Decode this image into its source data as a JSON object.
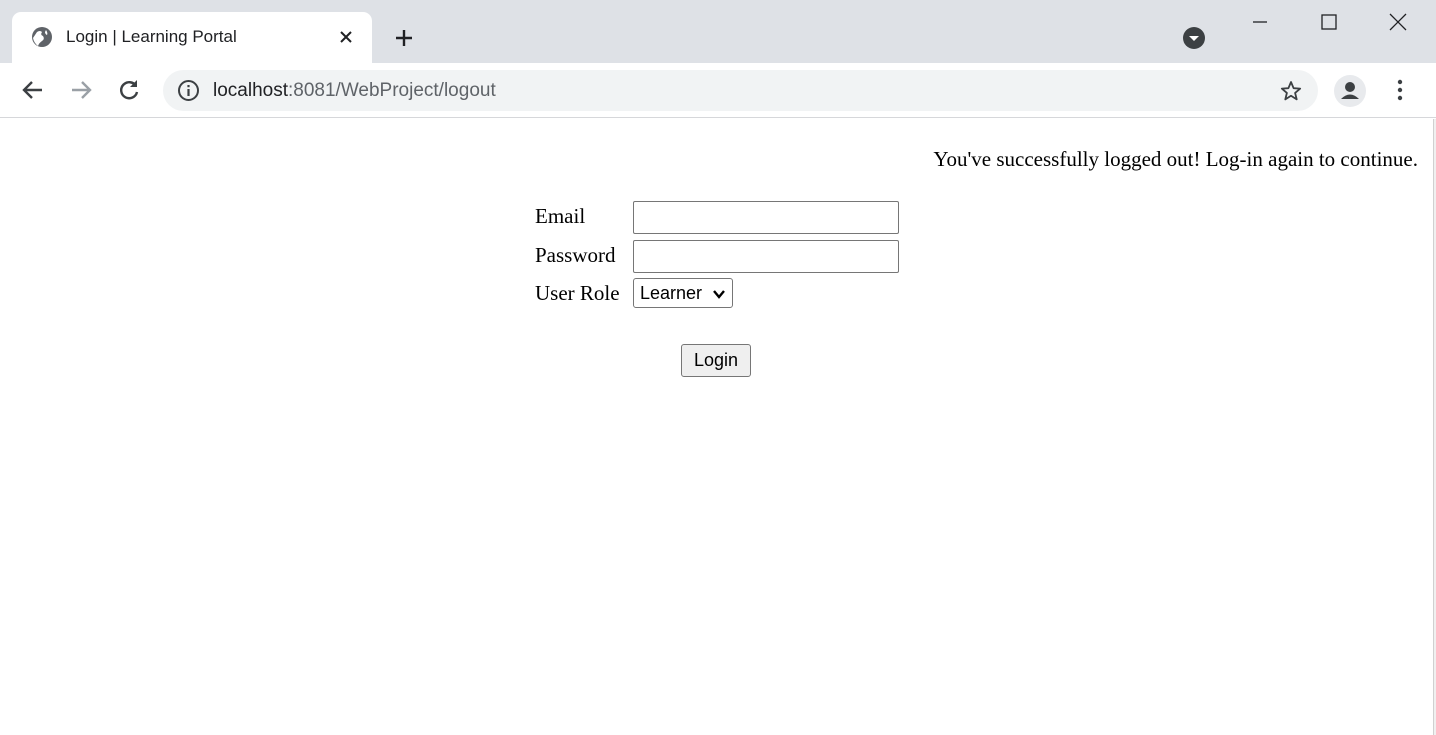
{
  "browser": {
    "tab": {
      "title": "Login | Learning Portal"
    },
    "address_bar": {
      "host": "localhost",
      "path": ":8081/WebProject/logout"
    },
    "icons": [
      "globe-icon",
      "close-icon",
      "plus-icon",
      "tab-search-icon",
      "minimize-icon",
      "maximize-icon",
      "close-window-icon",
      "back-arrow-icon",
      "forward-arrow-icon",
      "reload-icon",
      "info-icon",
      "star-icon",
      "profile-icon",
      "more-menu-icon"
    ]
  },
  "page": {
    "message": "You've successfully logged out! Log-in again to continue.",
    "form": {
      "email_label": "Email",
      "email_value": "",
      "password_label": "Password",
      "password_value": "",
      "role_label": "User Role",
      "role_selected": "Learner",
      "submit_label": "Login"
    }
  },
  "colors": {
    "titlebar": "#dee1e6",
    "omnibox": "#f1f3f4",
    "text": "#202124",
    "muted": "#5f6368"
  }
}
